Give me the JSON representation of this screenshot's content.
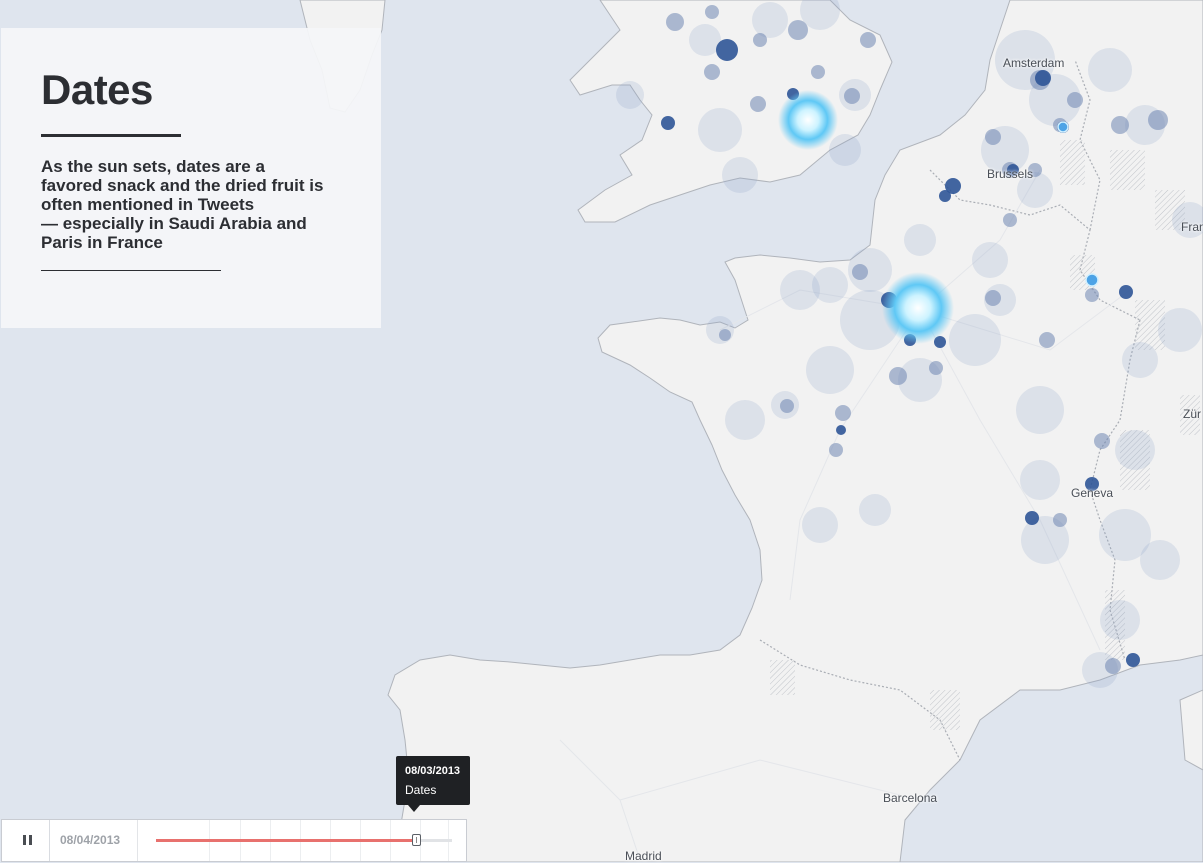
{
  "panel": {
    "title": "Dates",
    "body": "As the sun sets, dates are a\nfavored snack and the dried fruit is\noften mentioned in Tweets\n— especially in Saudi Arabia and\nParis in France"
  },
  "map": {
    "cities": [
      "Amsterdam",
      "Brussels",
      "Geneva",
      "Barcelona",
      "Madrid",
      "Zür",
      "Fran"
    ]
  },
  "tooltip": {
    "date": "08/03/2013",
    "name": "Dates"
  },
  "timeline": {
    "pause_icon": "pause-icon",
    "current_date": "08/04/2013",
    "progress": 0.88
  },
  "colors": {
    "land": "#f2f2f2",
    "sea": "#dfe5ee",
    "bubble": "#2f5597",
    "bubble_glow": "#7fd9ff",
    "timeline_accent": "#e8716e"
  }
}
